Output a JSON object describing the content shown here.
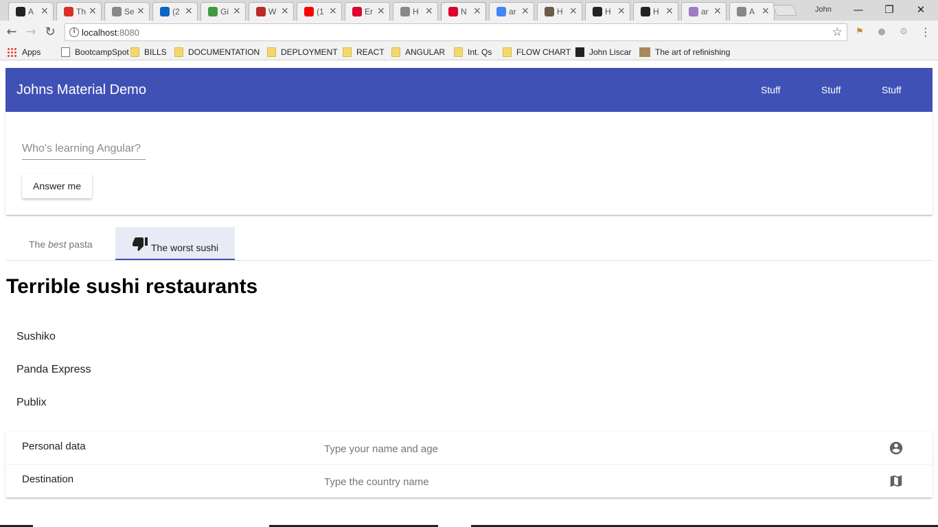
{
  "browser": {
    "tabs": [
      {
        "title": "A",
        "icon": "github-icon",
        "color": "#222222"
      },
      {
        "title": "Th",
        "icon": "gmail-icon",
        "color": "#d93025"
      },
      {
        "title": "Se",
        "icon": "page-icon",
        "color": "#888888"
      },
      {
        "title": "(2",
        "icon": "linkedin-icon",
        "color": "#0a66c2"
      },
      {
        "title": "Gi",
        "icon": "mongodb-icon",
        "color": "#3f9b3f"
      },
      {
        "title": "W",
        "icon": "quora-icon",
        "color": "#b92b27"
      },
      {
        "title": "(1",
        "icon": "youtube-icon",
        "color": "#ff0000"
      },
      {
        "title": "Er",
        "icon": "angular-icon",
        "color": "#dd0031"
      },
      {
        "title": "H",
        "icon": "page-icon",
        "color": "#888888"
      },
      {
        "title": "N",
        "icon": "angular-icon",
        "color": "#dd0031",
        "active": true
      },
      {
        "title": "ar",
        "icon": "google-icon",
        "color": "#4285f4"
      },
      {
        "title": "H",
        "icon": "herokuish-icon",
        "color": "#6b5b4b"
      },
      {
        "title": "H",
        "icon": "medium-icon",
        "color": "#222222"
      },
      {
        "title": "H",
        "icon": "medium-icon",
        "color": "#222222"
      },
      {
        "title": "ar",
        "icon": "heroku-icon",
        "color": "#9e7cc1"
      },
      {
        "title": "A",
        "icon": "page-icon",
        "color": "#888888"
      }
    ],
    "profile_name": "John",
    "url_host": "localhost",
    "url_port": ":8080",
    "bookmarks": [
      {
        "label": "Apps",
        "icon": "apps-grid-icon"
      },
      {
        "label": "BootcampSpot",
        "icon": "page-icon"
      },
      {
        "label": "BILLS",
        "icon": "folder-icon"
      },
      {
        "label": "DOCUMENTATION",
        "icon": "folder-icon"
      },
      {
        "label": "DEPLOYMENT",
        "icon": "folder-icon"
      },
      {
        "label": "REACT",
        "icon": "folder-icon"
      },
      {
        "label": "ANGULAR",
        "icon": "folder-icon"
      },
      {
        "label": "Int. Qs",
        "icon": "folder-icon"
      },
      {
        "label": "FLOW CHART",
        "icon": "folder-icon"
      },
      {
        "label": "John Liscar",
        "icon": "site-icon"
      },
      {
        "label": "The art of refinishing",
        "icon": "pga-icon"
      }
    ]
  },
  "app": {
    "toolbar_title": "Johns Material Demo",
    "nav_links": [
      "Stuff",
      "Stuff",
      "Stuff"
    ],
    "accent_color": "#3f51b5",
    "question_placeholder": "Who's learning Angular?",
    "answer_button": "Answer me",
    "tabs": [
      {
        "prefix": "The ",
        "emphasis": "best",
        "suffix": " pasta",
        "active": false
      },
      {
        "label": "The worst sushi",
        "icon": "thumb-down-icon",
        "active": true
      }
    ],
    "heading": "Terrible sushi restaurants",
    "restaurants": [
      "Sushiko",
      "Panda Express",
      "Publix"
    ],
    "panels": [
      {
        "title": "Personal data",
        "description": "Type your name and age",
        "icon": "account-circle-icon"
      },
      {
        "title": "Destination",
        "description": "Type the country name",
        "icon": "map-icon"
      }
    ]
  }
}
